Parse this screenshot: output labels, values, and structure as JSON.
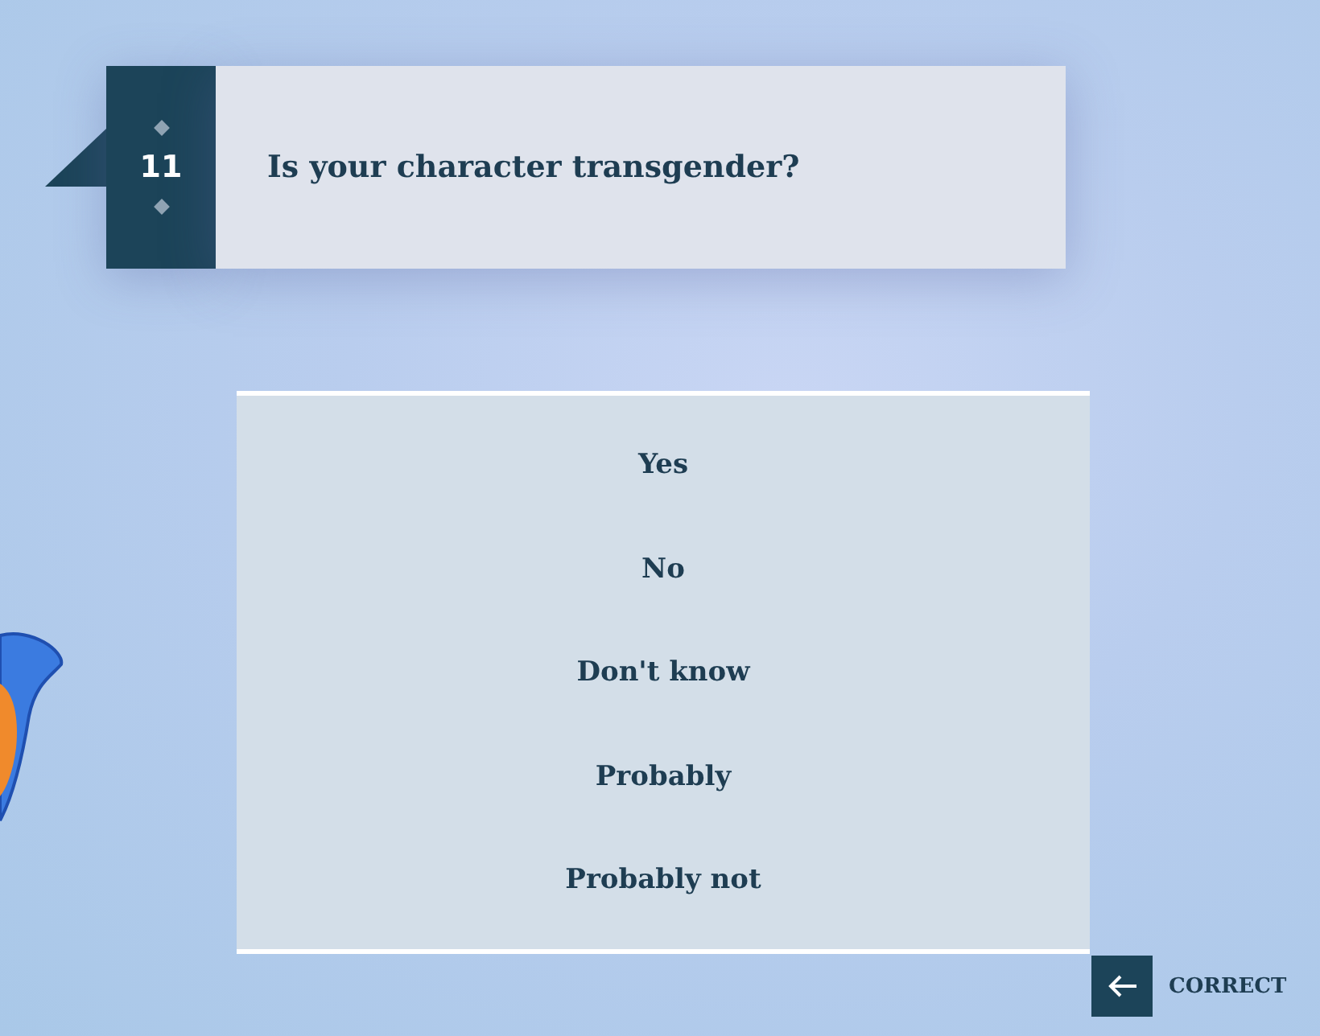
{
  "question": {
    "number": "11",
    "text": "Is your character transgender?"
  },
  "answers": [
    {
      "label": "Yes"
    },
    {
      "label": "No"
    },
    {
      "label": "Don't know"
    },
    {
      "label": "Probably"
    },
    {
      "label": "Probably not"
    }
  ],
  "correct_button": {
    "label": "CORRECT"
  }
}
